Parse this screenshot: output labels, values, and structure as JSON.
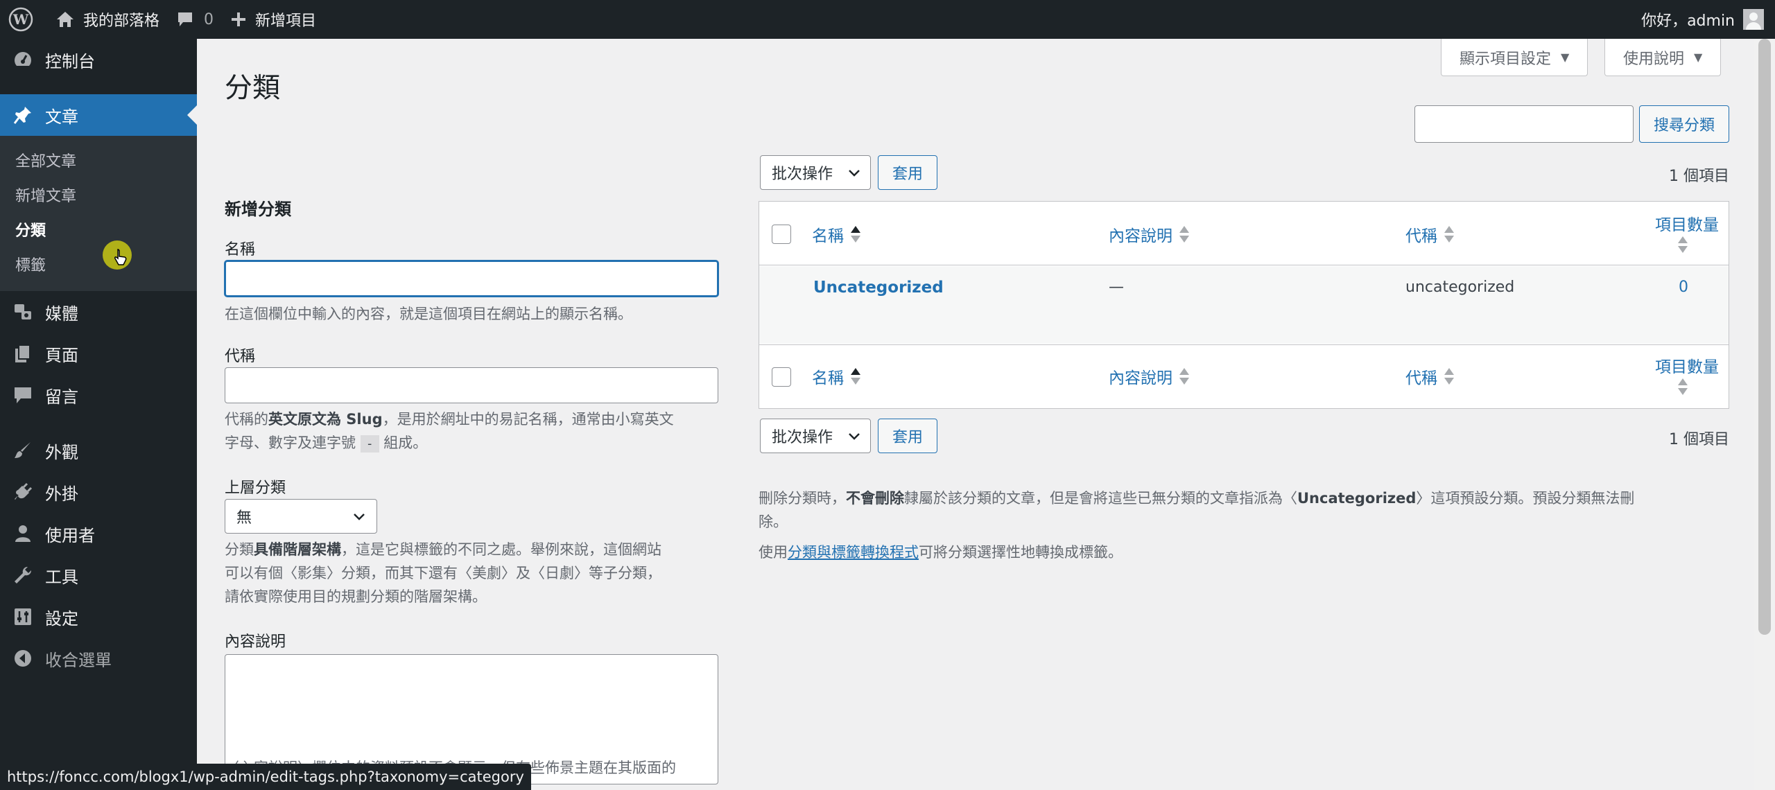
{
  "adminbar": {
    "site_name": "我的部落格",
    "comments_count": "0",
    "new_item": "新增項目",
    "greeting": "你好，admin"
  },
  "sidebar": {
    "dashboard": "控制台",
    "posts": "文章",
    "posts_sub": [
      "全部文章",
      "新增文章",
      "分類",
      "標籤"
    ],
    "media": "媒體",
    "pages": "頁面",
    "comments": "留言",
    "appearance": "外觀",
    "plugins": "外掛",
    "users": "使用者",
    "tools": "工具",
    "settings": "設定",
    "collapse": "收合選單"
  },
  "header": {
    "title": "分類",
    "screen_options": "顯示項目設定",
    "help": "使用說明"
  },
  "search": {
    "button": "搜尋分類",
    "placeholder": ""
  },
  "form": {
    "heading": "新增分類",
    "name_label": "名稱",
    "name_value": "",
    "name_desc": "在這個欄位中輸入的內容，就是這個項目在網站上的顯示名稱。",
    "slug_label": "代稱",
    "slug_value": "",
    "slug_desc_1": "代稱的",
    "slug_desc_bold": "英文原文為 Slug",
    "slug_desc_2": "，是用於網址中的易記名稱，通常由小寫英文",
    "slug_desc_3": "字母、數字及連字號",
    "slug_desc_chip": "-",
    "slug_desc_4": "組成。",
    "parent_label": "上層分類",
    "parent_value": "無",
    "parent_desc_1": "分類",
    "parent_desc_bold": "具備階層架構",
    "parent_desc_2": "，這是它與標籤的不同之處。舉例來說，這個網站",
    "parent_desc_3": "可以有個〈影集〉分類，而其下還有〈美劇〉及〈日劇〉等子分類，",
    "parent_desc_4": "請依實際使用目的規劃分類的階層架構。",
    "description_label": "內容說明",
    "cut_text": "〈內容說明〉欄位中的資料預設不會顯示，但有些佈景主題在其版面的"
  },
  "table": {
    "bulk_actions": "批次操作",
    "apply": "套用",
    "item_count": "1 個項目",
    "columns": [
      "名稱",
      "內容說明",
      "代稱",
      "項目數量"
    ],
    "rows": [
      {
        "name": "Uncategorized",
        "description": "—",
        "slug": "uncategorized",
        "count": "0"
      }
    ]
  },
  "notes": {
    "delete_1": "刪除分類時，",
    "delete_bold": "不會刪除",
    "delete_2": "隸屬於該分類的文章，但是會將這些已無分類的文章指派為〈",
    "delete_bold2": "Uncategorized",
    "delete_3": "〉這項預設分類。預設分類無法刪",
    "delete_4": "除。",
    "convert_1": "使用",
    "convert_link": "分類與標籤轉換程式",
    "convert_2": "可將分類選擇性地轉換成標籤。"
  },
  "statusbar": {
    "url": "https://foncc.com/blogx1/wp-admin/edit-tags.php?taxonomy=category"
  },
  "colors": {
    "admin_dark": "#1d2327",
    "accent": "#2271b1",
    "background": "#f0f0f1"
  }
}
